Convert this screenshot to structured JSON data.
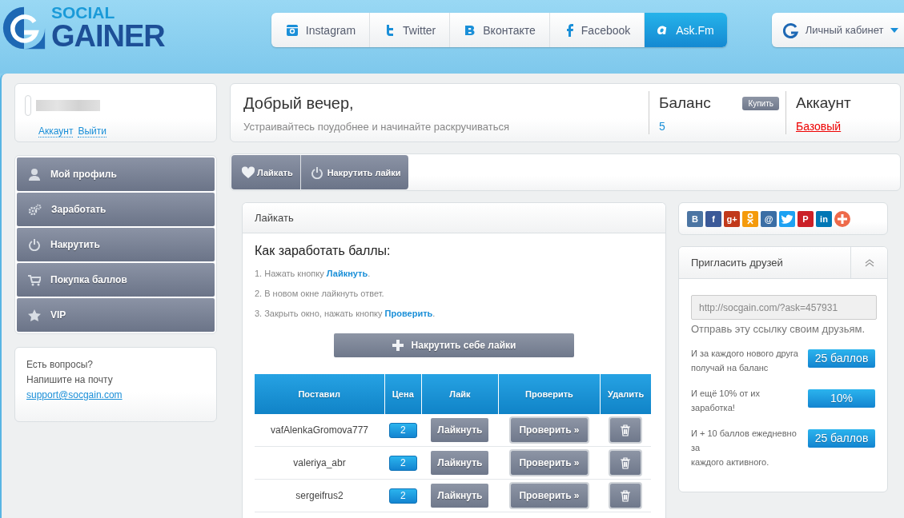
{
  "logo": {
    "top": "SOCIAL",
    "bottom": "GAINER"
  },
  "nav": [
    {
      "kind": "instagram",
      "label": "Instagram",
      "selected": false
    },
    {
      "kind": "twitter",
      "label": "Twitter",
      "selected": false
    },
    {
      "kind": "vk",
      "label": "Вконтакте",
      "selected": false
    },
    {
      "kind": "facebook",
      "label": "Facebook",
      "selected": false
    },
    {
      "kind": "askfm",
      "label": "Ask.Fm",
      "selected": true
    }
  ],
  "cabinet": {
    "label": "Личный кабинет"
  },
  "user": {
    "links": [
      "Аккаунт",
      "Выйти"
    ]
  },
  "sidebar": {
    "items": [
      {
        "kind": "user",
        "label": "Мой профиль"
      },
      {
        "kind": "gears",
        "label": "Заработать"
      },
      {
        "kind": "power",
        "label": "Накрутить"
      },
      {
        "kind": "cart",
        "label": "Покупка баллов"
      },
      {
        "kind": "star",
        "label": "VIP"
      }
    ]
  },
  "help": {
    "lines": [
      "Есть вопросы?",
      "Напишите на почту"
    ],
    "email": "support@socgain.com"
  },
  "greeting": {
    "title": "Добрый вечер,",
    "subtitle": "Устраивайтесь поудобнее и начинайте раскручиваться"
  },
  "balance": {
    "title": "Баланс",
    "button": "Купить",
    "value": "5"
  },
  "account": {
    "title": "Аккаунт",
    "value": "Базовый"
  },
  "action_tabs": [
    {
      "kind": "heart",
      "label": "Лайкать"
    },
    {
      "kind": "power",
      "label": "Накрутить лайки"
    }
  ],
  "panel": {
    "title": "Лайкать",
    "heading": "Как заработать баллы:",
    "steps": [
      "1. Нажать кнопку **Лайкнуть**.",
      "2. В новом окне лайкнуть ответ.",
      "3. Закрыть окно, нажать кнопку **Проверить**."
    ],
    "boost_button": "Накрутить себе лайки"
  },
  "table": {
    "columns": [
      "Поставил",
      "Цена",
      "Лайк",
      "Проверить",
      "Удалить"
    ],
    "rows": [
      {
        "user": "vafAlenkaGromova777",
        "price": "2",
        "like": "Лайкнуть",
        "check": "Проверить »"
      },
      {
        "user": "valeriya_abr",
        "price": "2",
        "like": "Лайкнуть",
        "check": "Проверить »"
      },
      {
        "user": "sergeifrus2",
        "price": "2",
        "like": "Лайкнуть",
        "check": "Проверить »"
      }
    ]
  },
  "share": [
    {
      "kind": "vk",
      "label": "B",
      "color": "#4c75a3"
    },
    {
      "kind": "facebook",
      "label": "f",
      "color": "#3b5998"
    },
    {
      "kind": "gplus",
      "label": "g+",
      "color": "#c1391b"
    },
    {
      "kind": "ok",
      "color": "#f49a0c"
    },
    {
      "kind": "mail",
      "label": "@",
      "color": "#3b6ea5"
    },
    {
      "kind": "twitter",
      "color": "#1da1f2"
    },
    {
      "kind": "pinterest",
      "label": "P",
      "color": "#cb2027"
    },
    {
      "kind": "linkedin",
      "label": "in",
      "color": "#0077b5"
    },
    {
      "kind": "more",
      "color": "#ee6a4a"
    }
  ],
  "invite": {
    "title": "Пригласить друзей",
    "link": "http://socgain.com/?ask=457931",
    "hint": "Отправь эту ссылку своим друзьям.",
    "rewards": [
      {
        "text": "И за каждого нового друга получай на баланс",
        "badge": "25 баллов"
      },
      {
        "text": "И ещё 10% от их заработка!",
        "badge": "10%"
      },
      {
        "text": "И + 10 баллов ежедневно за\nкаждого активного.",
        "badge": "25 баллов"
      }
    ]
  }
}
